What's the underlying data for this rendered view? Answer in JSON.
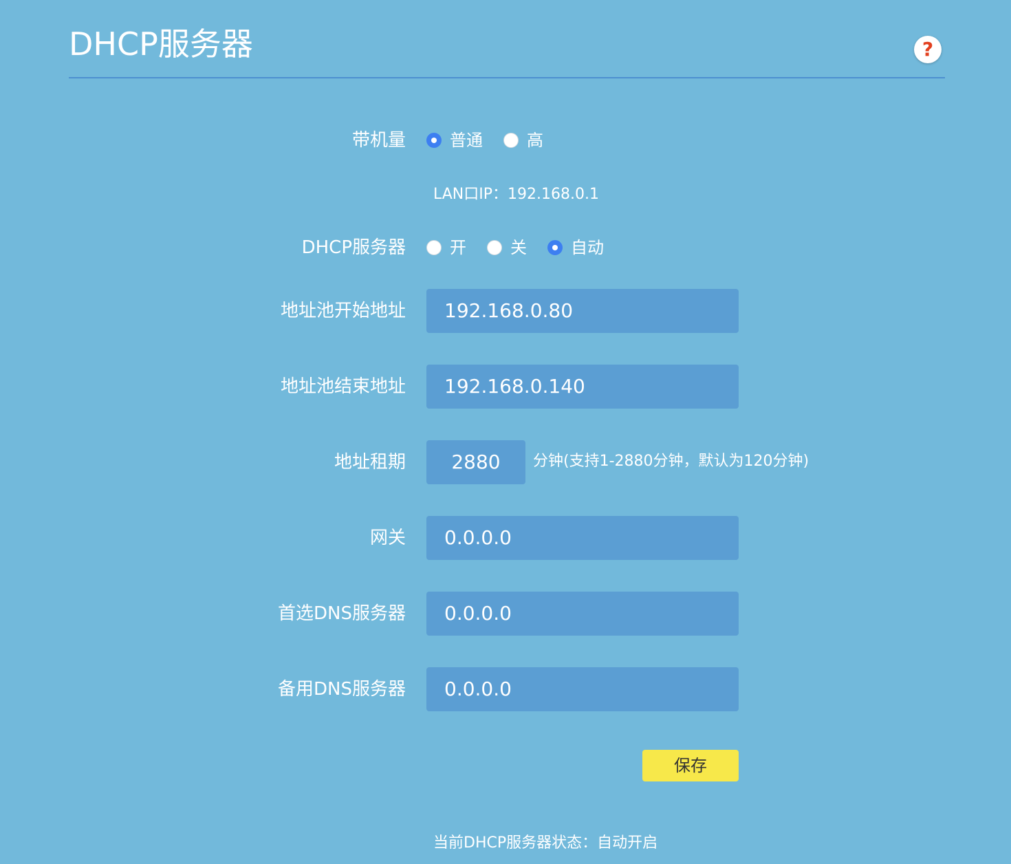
{
  "header": {
    "title": "DHCP服务器",
    "help_icon": "question-mark-icon",
    "help_glyph": "?"
  },
  "capacity": {
    "label": "带机量",
    "options": [
      {
        "label": "普通",
        "selected": true
      },
      {
        "label": "高",
        "selected": false
      }
    ]
  },
  "lan_ip": "LAN口IP：192.168.0.1",
  "dhcp_server": {
    "label": "DHCP服务器",
    "options": [
      {
        "label": "开",
        "selected": false
      },
      {
        "label": "关",
        "selected": false
      },
      {
        "label": "自动",
        "selected": true
      }
    ]
  },
  "fields": {
    "pool_start": {
      "label": "地址池开始地址",
      "value": "192.168.0.80"
    },
    "pool_end": {
      "label": "地址池结束地址",
      "value": "192.168.0.140"
    },
    "lease": {
      "label": "地址租期",
      "value": "2880",
      "hint": "分钟(支持1-2880分钟，默认为120分钟)"
    },
    "gateway": {
      "label": "网关",
      "value": "0.0.0.0"
    },
    "dns_primary": {
      "label": "首选DNS服务器",
      "value": "0.0.0.0"
    },
    "dns_secondary": {
      "label": "备用DNS服务器",
      "value": "0.0.0.0"
    }
  },
  "save_label": "保存",
  "status_text": "当前DHCP服务器状态：自动开启",
  "colors": {
    "background": "#72b9db",
    "field": "#5b9ed3",
    "divider": "#4d8fcf",
    "radio_selected": "#3d7ff1",
    "save_button": "#f7e84a",
    "help_icon": "#e2401f"
  }
}
